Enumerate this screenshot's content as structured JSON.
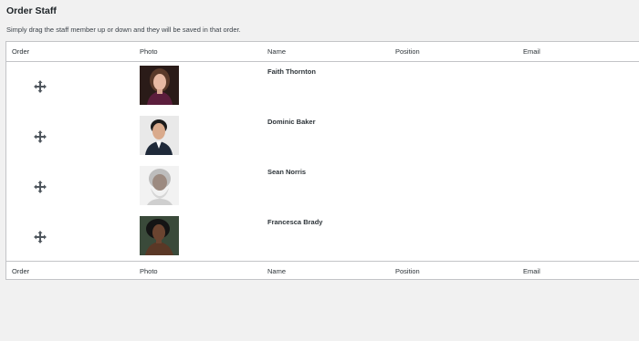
{
  "page": {
    "title": "Order Staff",
    "description": "Simply drag the staff member up or down and they will be saved in that order."
  },
  "table": {
    "columns": [
      "Order",
      "Photo",
      "Name",
      "Position",
      "Email"
    ],
    "rows": [
      {
        "name": "Faith Thornton",
        "position": "",
        "email": ""
      },
      {
        "name": "Dominic Baker",
        "position": "",
        "email": ""
      },
      {
        "name": "Sean Norris",
        "position": "",
        "email": ""
      },
      {
        "name": "Francesca Brady",
        "position": "",
        "email": ""
      }
    ]
  },
  "icons": {
    "drag": "move-arrows-icon"
  }
}
